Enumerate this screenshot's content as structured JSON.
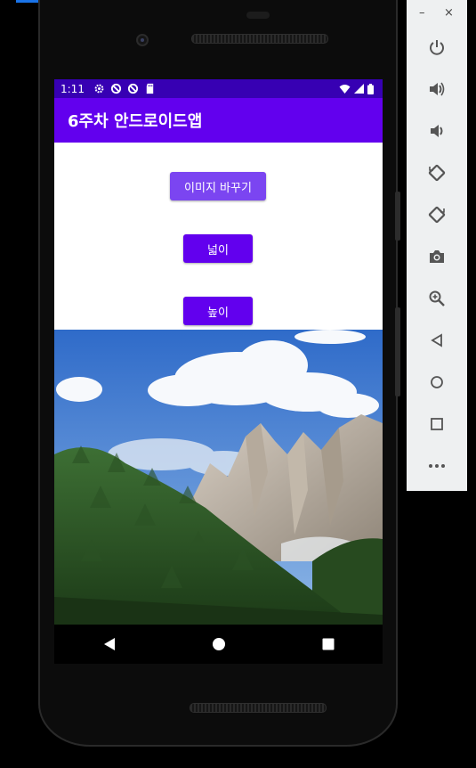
{
  "status_bar": {
    "time": "1:11"
  },
  "app": {
    "title": "6주차 안드로이드앱",
    "buttons": {
      "change_image": "이미지 바꾸기",
      "width": "넓이",
      "height": "높이"
    }
  },
  "photo": {
    "description_icon": "mountain-landscape-image"
  },
  "nav_bar": {
    "items": [
      "back-icon",
      "home-icon",
      "recents-icon"
    ]
  },
  "emulator_toolbar": {
    "minimize": "–",
    "close": "×",
    "items": [
      "power-icon",
      "volume-up-icon",
      "volume-down-icon",
      "rotate-left-icon",
      "rotate-right-icon",
      "camera-icon",
      "zoom-icon",
      "back-icon",
      "home-icon",
      "overview-icon",
      "more-icon"
    ]
  },
  "colors": {
    "status_bar": "#3700b3",
    "app_bar": "#6200ee",
    "button": "#6200ee",
    "button_light": "#7b45f1"
  }
}
